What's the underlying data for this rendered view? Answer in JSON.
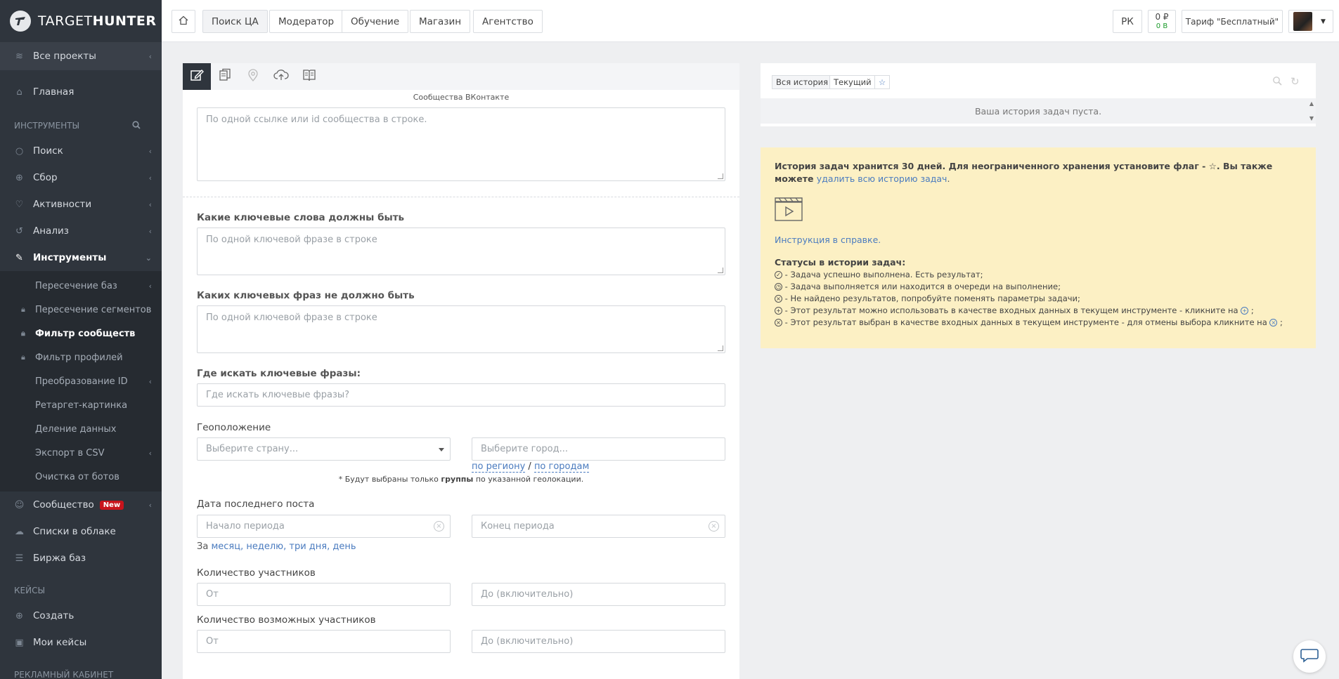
{
  "brand": {
    "name_light": "TARGET",
    "name_bold": "HUNTER"
  },
  "sidebar": {
    "projects": "Все проекты",
    "home": "Главная",
    "section_tools": "ИНСТРУМЕНТЫ",
    "items": [
      {
        "label": "Поиск"
      },
      {
        "label": "Сбор"
      },
      {
        "label": "Активности"
      },
      {
        "label": "Анализ"
      },
      {
        "label": "Инструменты"
      }
    ],
    "sub_items": [
      {
        "label": "Пересечение баз"
      },
      {
        "label": "Пересечение сегментов"
      },
      {
        "label": "Фильтр сообществ"
      },
      {
        "label": "Фильтр профилей"
      },
      {
        "label": "Преобразование ID"
      },
      {
        "label": "Ретаргет-картинка"
      },
      {
        "label": "Деление данных"
      },
      {
        "label": "Экспорт в CSV"
      },
      {
        "label": "Очистка от ботов"
      }
    ],
    "community": "Сообщество",
    "community_badge": "New",
    "cloud_lists": "Списки в облаке",
    "exchange": "Биржа баз",
    "section_cases": "КЕЙСЫ",
    "create": "Создать",
    "my_cases": "Мои кейсы",
    "section_ads": "РЕКЛАМНЫЙ КАБИНЕТ"
  },
  "topbar": {
    "nav": [
      "Поиск ЦА",
      "Модератор",
      "Обучение",
      "Магазин",
      "Агентство"
    ],
    "rk": "РК",
    "balance_rub": "0 ₽",
    "balance_b": "0 B",
    "tariff": "Тариф \"Бесплатный\""
  },
  "form": {
    "vk_caption": "Сообщества ВКонтакте",
    "vk_placeholder": "По одной ссылке или id сообщества в строке.",
    "kw_must_label": "Какие ключевые слова должны быть",
    "kw_must_placeholder": "По одной ключевой фразе в строке",
    "kw_not_label": "Каких ключевых фраз не должно быть",
    "kw_not_placeholder": "По одной ключевой фразе в строке",
    "where_label": "Где искать ключевые фразы:",
    "where_placeholder": "Где искать ключевые фразы?",
    "geo_label": "Геоположение",
    "country_placeholder": "Выберите страну...",
    "city_placeholder": "Выберите город...",
    "by_region": "по региону",
    "slash": "/",
    "by_cities": "по городам",
    "geo_note_pre": "* Будут выбраны только ",
    "geo_note_bold": "группы",
    "geo_note_post": " по указанной геолокации.",
    "last_post_label": "Дата последнего поста",
    "period_start": "Начало периода",
    "period_end": "Конец периода",
    "quick_prefix": "За",
    "quick_month": "месяц,",
    "quick_week": "неделю,",
    "quick_3days": "три дня,",
    "quick_day": "день",
    "members_label": "Количество участников",
    "members_from": "От",
    "members_to": "До (включительно)",
    "possible_label": "Количество возможных участников",
    "possible_from": "От",
    "possible_to": "До (включительно)"
  },
  "history": {
    "all": "Вся история",
    "current": "Текущий",
    "empty": "Ваша история задач пуста."
  },
  "info": {
    "text1": "История задач хранится 30 дней. Для неограниченного хранения установите флаг - ☆. Вы также можете ",
    "link_delete": "удалить всю историю задач",
    "dot": ".",
    "help_link": "Инструкция в справке.",
    "statuses_title": "Статусы в истории задач:",
    "statuses": [
      {
        "icon": "✓",
        "text": " - Задача успешно выполнена. Есть результат;"
      },
      {
        "icon": "◷",
        "text": " - Задача выполняется или находится в очереди на выполнение;"
      },
      {
        "icon": "×",
        "text": " - Не найдено результатов, попробуйте поменять параметры задачи;"
      },
      {
        "icon": "+",
        "text": " - Этот результат можно использовать в качестве входных данных в текущем инструменте - кликните на ",
        "tail_icon": "+",
        "tail": " ;"
      },
      {
        "icon": "×",
        "text": " - Этот результат выбран в качестве входных данных в текущем инструменте - для отмены выбора кликните на ",
        "tail_icon": "×",
        "tail": " ;"
      }
    ]
  }
}
